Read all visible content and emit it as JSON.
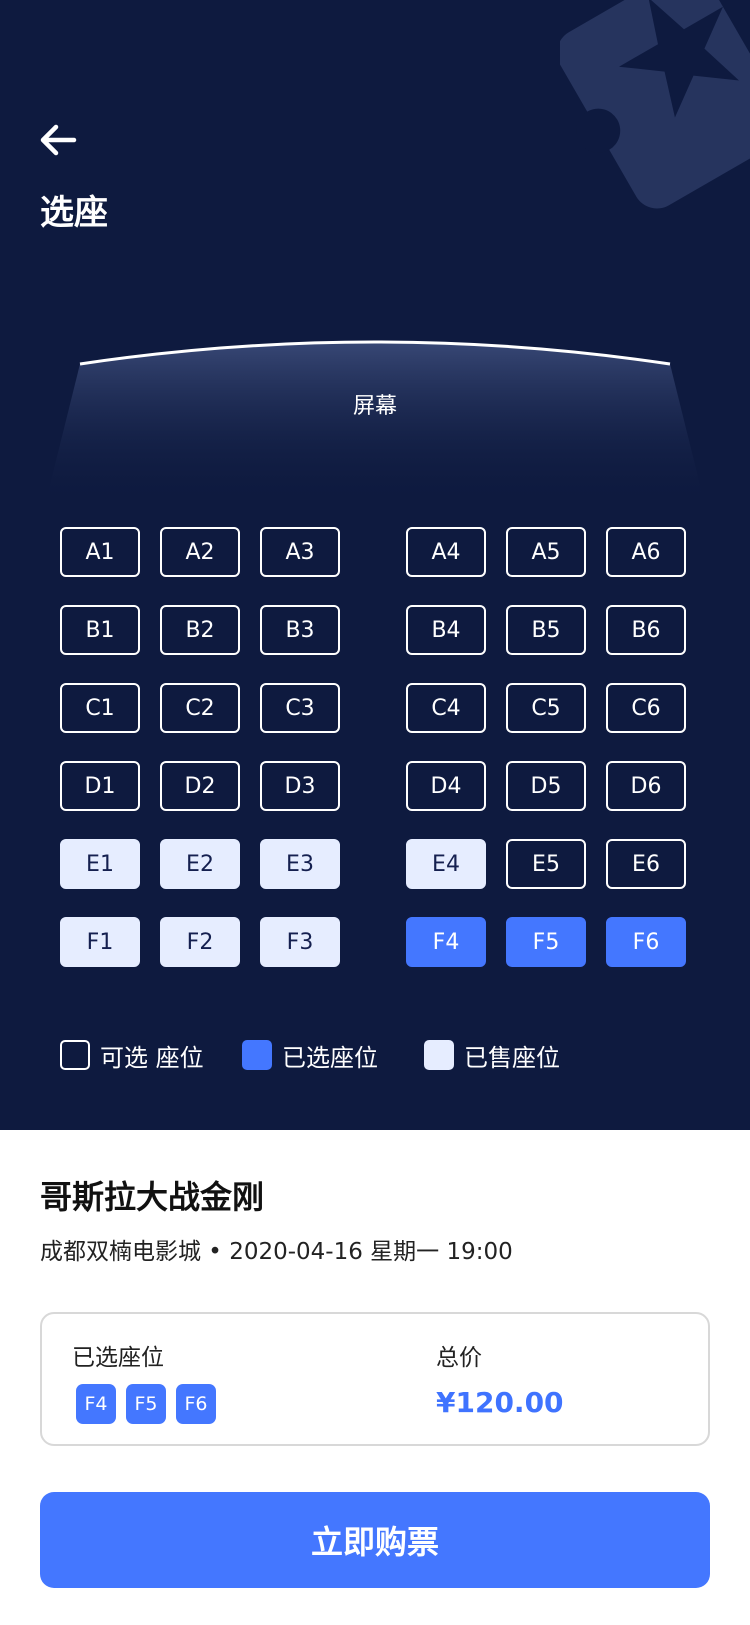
{
  "header": {
    "title": "选座",
    "back_icon": "arrow-left-icon"
  },
  "screen": {
    "label": "屏幕"
  },
  "seats": {
    "rows": [
      {
        "left": [
          {
            "id": "A1",
            "status": "available"
          },
          {
            "id": "A2",
            "status": "available"
          },
          {
            "id": "A3",
            "status": "available"
          }
        ],
        "right": [
          {
            "id": "A4",
            "status": "available"
          },
          {
            "id": "A5",
            "status": "available"
          },
          {
            "id": "A6",
            "status": "available"
          }
        ]
      },
      {
        "left": [
          {
            "id": "B1",
            "status": "available"
          },
          {
            "id": "B2",
            "status": "available"
          },
          {
            "id": "B3",
            "status": "available"
          }
        ],
        "right": [
          {
            "id": "B4",
            "status": "available"
          },
          {
            "id": "B5",
            "status": "available"
          },
          {
            "id": "B6",
            "status": "available"
          }
        ]
      },
      {
        "left": [
          {
            "id": "C1",
            "status": "available"
          },
          {
            "id": "C2",
            "status": "available"
          },
          {
            "id": "C3",
            "status": "available"
          }
        ],
        "right": [
          {
            "id": "C4",
            "status": "available"
          },
          {
            "id": "C5",
            "status": "available"
          },
          {
            "id": "C6",
            "status": "available"
          }
        ]
      },
      {
        "left": [
          {
            "id": "D1",
            "status": "available"
          },
          {
            "id": "D2",
            "status": "available"
          },
          {
            "id": "D3",
            "status": "available"
          }
        ],
        "right": [
          {
            "id": "D4",
            "status": "available"
          },
          {
            "id": "D5",
            "status": "available"
          },
          {
            "id": "D6",
            "status": "available"
          }
        ]
      },
      {
        "left": [
          {
            "id": "E1",
            "status": "sold"
          },
          {
            "id": "E2",
            "status": "sold"
          },
          {
            "id": "E3",
            "status": "sold"
          }
        ],
        "right": [
          {
            "id": "E4",
            "status": "sold"
          },
          {
            "id": "E5",
            "status": "available"
          },
          {
            "id": "E6",
            "status": "available"
          }
        ]
      },
      {
        "left": [
          {
            "id": "F1",
            "status": "sold"
          },
          {
            "id": "F2",
            "status": "sold"
          },
          {
            "id": "F3",
            "status": "sold"
          }
        ],
        "right": [
          {
            "id": "F4",
            "status": "selected"
          },
          {
            "id": "F5",
            "status": "selected"
          },
          {
            "id": "F6",
            "status": "selected"
          }
        ]
      }
    ]
  },
  "legend": {
    "available": "可选 座位",
    "selected": "已选座位",
    "sold": "已售座位"
  },
  "movie": {
    "title": "哥斯拉大战金刚",
    "info": "成都双楠电影城 • 2020-04-16 星期一 19:00"
  },
  "summary": {
    "selected_label": "已选座位",
    "selected_seats": [
      "F4",
      "F5",
      "F6"
    ],
    "total_label": "总价",
    "total_price": "¥120.00"
  },
  "buy_button": {
    "label": "立即购票"
  },
  "colors": {
    "background_dark": "#0e1a3f",
    "accent": "#4477ff",
    "sold": "#e6edff"
  }
}
